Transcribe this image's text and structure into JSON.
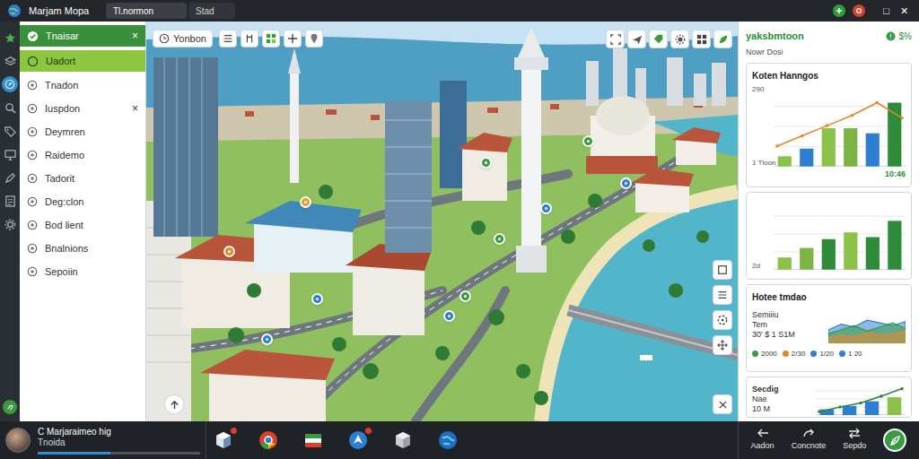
{
  "window": {
    "title": "Marjam Mopa",
    "tabs": [
      {
        "label": "Tl.normon",
        "selected": true
      },
      {
        "label": "Stad",
        "selected": false
      }
    ],
    "indicators": [
      {
        "color": "#2e9e3a"
      },
      {
        "color": "#d9412b"
      }
    ],
    "controls": [
      "□",
      "✕"
    ]
  },
  "rail": [
    {
      "selected": false
    },
    {
      "selected": false
    },
    {
      "selected": true
    },
    {
      "selected": false
    },
    {
      "selected": false
    },
    {
      "selected": false
    },
    {
      "selected": false
    },
    {
      "selected": false
    },
    {
      "selected": false
    }
  ],
  "sidebar": {
    "items": [
      {
        "label": "Tnaisar",
        "selected": true,
        "highlighted": false,
        "close": "×"
      },
      {
        "label": "Uadort",
        "selected": false,
        "highlighted": true
      },
      {
        "label": "Tnadon",
        "selected": false,
        "highlighted": false
      },
      {
        "label": "Iuspdon",
        "selected": false,
        "highlighted": false,
        "close": "×"
      },
      {
        "label": "Deymren",
        "selected": false,
        "highlighted": false
      },
      {
        "label": "Raidemo",
        "selected": false,
        "highlighted": false
      },
      {
        "label": "Tadorit",
        "selected": false,
        "highlighted": false
      },
      {
        "label": "Deg:clon",
        "selected": false,
        "highlighted": false
      },
      {
        "label": "Bod lient",
        "selected": false,
        "highlighted": false
      },
      {
        "label": "Bnalnions",
        "selected": false,
        "highlighted": false
      },
      {
        "label": "Sepoiin",
        "selected": false,
        "highlighted": false
      }
    ]
  },
  "map": {
    "toolbar": {
      "label": "Yonbon"
    },
    "pins": [
      {
        "color": "#e8a02a"
      },
      {
        "color": "#e8862a"
      },
      {
        "color": "#2f7fd1"
      },
      {
        "color": "#2f7fd1"
      },
      {
        "color": "#2f7fd1"
      },
      {
        "color": "#3a9a3f"
      },
      {
        "color": "#3a9a3f"
      },
      {
        "color": "#2f7fd1"
      },
      {
        "color": "#3a9a3f"
      },
      {
        "color": "#2f7fd1"
      },
      {
        "color": "#3a9a3f"
      }
    ]
  },
  "right_panel": {
    "title": "yaksbmtoon",
    "badge": "$%",
    "subtitle": "Nowr Dosi",
    "cards": [
      {
        "kind": "chart",
        "title": "Koten Hanngos",
        "ticks": [
          "290",
          "1 Tloon"
        ],
        "time": "10:46",
        "max": 300,
        "bars": [
          {
            "value": 40,
            "color": "#8bc34a"
          },
          {
            "value": 70,
            "color": "#2f7fd1"
          },
          {
            "value": 150,
            "color": "#8bc34a"
          },
          {
            "value": 150,
            "color": "#7cb342"
          },
          {
            "value": 130,
            "color": "#2f7fd1"
          },
          {
            "value": 250,
            "color": "#2e8b3a"
          }
        ],
        "line": [
          80,
          120,
          160,
          200,
          250,
          190
        ]
      },
      {
        "kind": "chart",
        "ticks": [
          "2d"
        ],
        "max": 100,
        "bars": [
          {
            "value": 18,
            "color": "#8bc34a"
          },
          {
            "value": 32,
            "color": "#7cb342"
          },
          {
            "value": 45,
            "color": "#2e8b3a"
          },
          {
            "value": 55,
            "color": "#8bc34a"
          },
          {
            "value": 48,
            "color": "#2e8b3a"
          },
          {
            "value": 72,
            "color": "#2e8b3a"
          }
        ]
      },
      {
        "kind": "summary",
        "title": "Hotee tmdao",
        "lines": [
          "Semiiiu",
          "Tem",
          "30' $ 1 S1M"
        ],
        "max": 50,
        "areas": [
          {
            "color": "#2f7fd1",
            "values": [
              20,
              28,
              24,
              34,
              30,
              26,
              32
            ]
          },
          {
            "color": "#3a9a3f",
            "values": [
              14,
              20,
              26,
              18,
              24,
              30,
              22
            ]
          },
          {
            "color": "#e8862a",
            "values": [
              8,
              12,
              10,
              16,
              12,
              14,
              18
            ]
          }
        ],
        "legend": [
          {
            "label": "2000",
            "color": "#3a9a3f"
          },
          {
            "label": "2/30",
            "color": "#e8862a"
          },
          {
            "label": "1/20",
            "color": "#2f7fd1"
          },
          {
            "label": "1 20",
            "color": "#2f7fd1"
          }
        ]
      },
      {
        "kind": "compact",
        "lines": [
          "Secdig",
          "Nae",
          "10 M"
        ],
        "max": 100,
        "bars": [
          {
            "value": 20,
            "color": "#2f7fd1"
          },
          {
            "value": 32,
            "color": "#2f7fd1"
          },
          {
            "value": 48,
            "color": "#2f7fd1"
          },
          {
            "value": 62,
            "color": "#8bc34a"
          }
        ],
        "line": [
          12,
          28,
          42,
          66,
          92
        ]
      }
    ]
  },
  "taskbar": {
    "user": {
      "name": "C Marjaraimeo hig",
      "status": "Tnoida",
      "level": 0.45
    },
    "apps": [
      {
        "badge": true
      },
      {
        "badge": false
      },
      {
        "badge": false
      },
      {
        "badge": true
      },
      {
        "badge": false
      },
      {
        "badge": false
      }
    ],
    "actions": [
      "Aadon",
      "Concnote",
      "Sepdo"
    ]
  }
}
